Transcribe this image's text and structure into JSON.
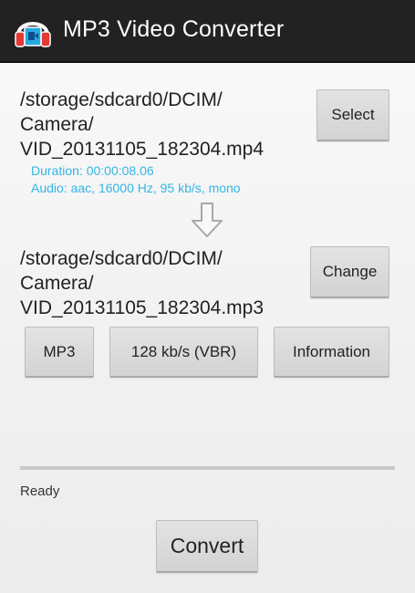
{
  "app": {
    "title": "MP3 Video Converter",
    "icon": "headphones-video-icon",
    "accent_color": "#33b5e5",
    "actionbar_color": "#222222"
  },
  "source": {
    "path_lines": [
      "/storage/sdcard0/DCIM/",
      "Camera/",
      "VID_20131105_182304.mp4"
    ],
    "duration": "Duration: 00:00:08.06",
    "audio": "Audio: aac, 16000 Hz, 95 kb/s, mono",
    "select_label": "Select"
  },
  "arrow": {
    "icon": "arrow-down-icon"
  },
  "output": {
    "path_lines": [
      "/storage/sdcard0/DCIM/",
      "Camera/",
      "VID_20131105_182304.mp3"
    ],
    "change_label": "Change"
  },
  "options": {
    "format_label": "MP3",
    "bitrate_label": "128  kb/s (VBR)",
    "information_label": "Information"
  },
  "progress": {
    "value": 0
  },
  "status": {
    "text": "Ready"
  },
  "convert_label": "Convert"
}
